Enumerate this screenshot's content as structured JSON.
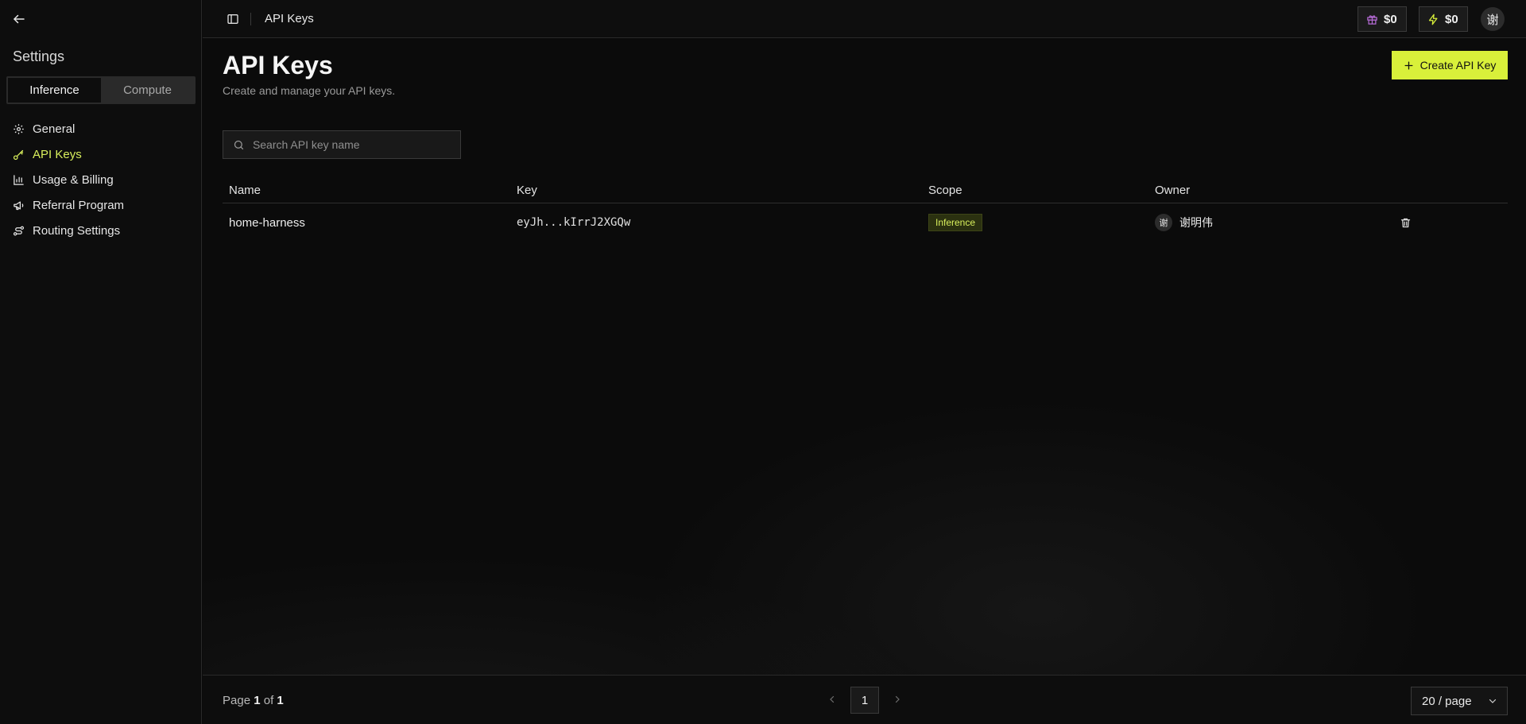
{
  "sidebar": {
    "title": "Settings",
    "segments": [
      {
        "label": "Inference",
        "active": true
      },
      {
        "label": "Compute",
        "active": false
      }
    ],
    "items": [
      {
        "label": "General",
        "icon": "gear-icon"
      },
      {
        "label": "API Keys",
        "icon": "key-icon",
        "active": true
      },
      {
        "label": "Usage & Billing",
        "icon": "bar-chart-icon"
      },
      {
        "label": "Referral Program",
        "icon": "megaphone-icon"
      },
      {
        "label": "Routing Settings",
        "icon": "route-icon"
      }
    ]
  },
  "topbar": {
    "breadcrumb": "API Keys",
    "credits": [
      {
        "icon": "gift-icon",
        "value": "$0",
        "color": "#b66bd6"
      },
      {
        "icon": "lightning-icon",
        "value": "$0",
        "color": "#d9f03a"
      }
    ],
    "avatar": "谢"
  },
  "page": {
    "title": "API Keys",
    "subtitle": "Create and manage your API keys.",
    "create_label": "Create API Key",
    "search_placeholder": "Search API key name"
  },
  "table": {
    "columns": [
      "Name",
      "Key",
      "Scope",
      "Owner"
    ],
    "rows": [
      {
        "name": "home-harness",
        "key": "eyJh...kIrrJ2XGQw",
        "scope": "Inference",
        "owner_avatar": "谢",
        "owner": "谢明伟"
      }
    ]
  },
  "footer": {
    "page_label": "Page",
    "page_current": "1",
    "page_of": "of",
    "page_total": "1",
    "current_page_button": "1",
    "per_page": "20 / page"
  },
  "colors": {
    "accent": "#d9f03a",
    "active_nav": "#d8ef5c",
    "background": "#0b0b0b"
  }
}
